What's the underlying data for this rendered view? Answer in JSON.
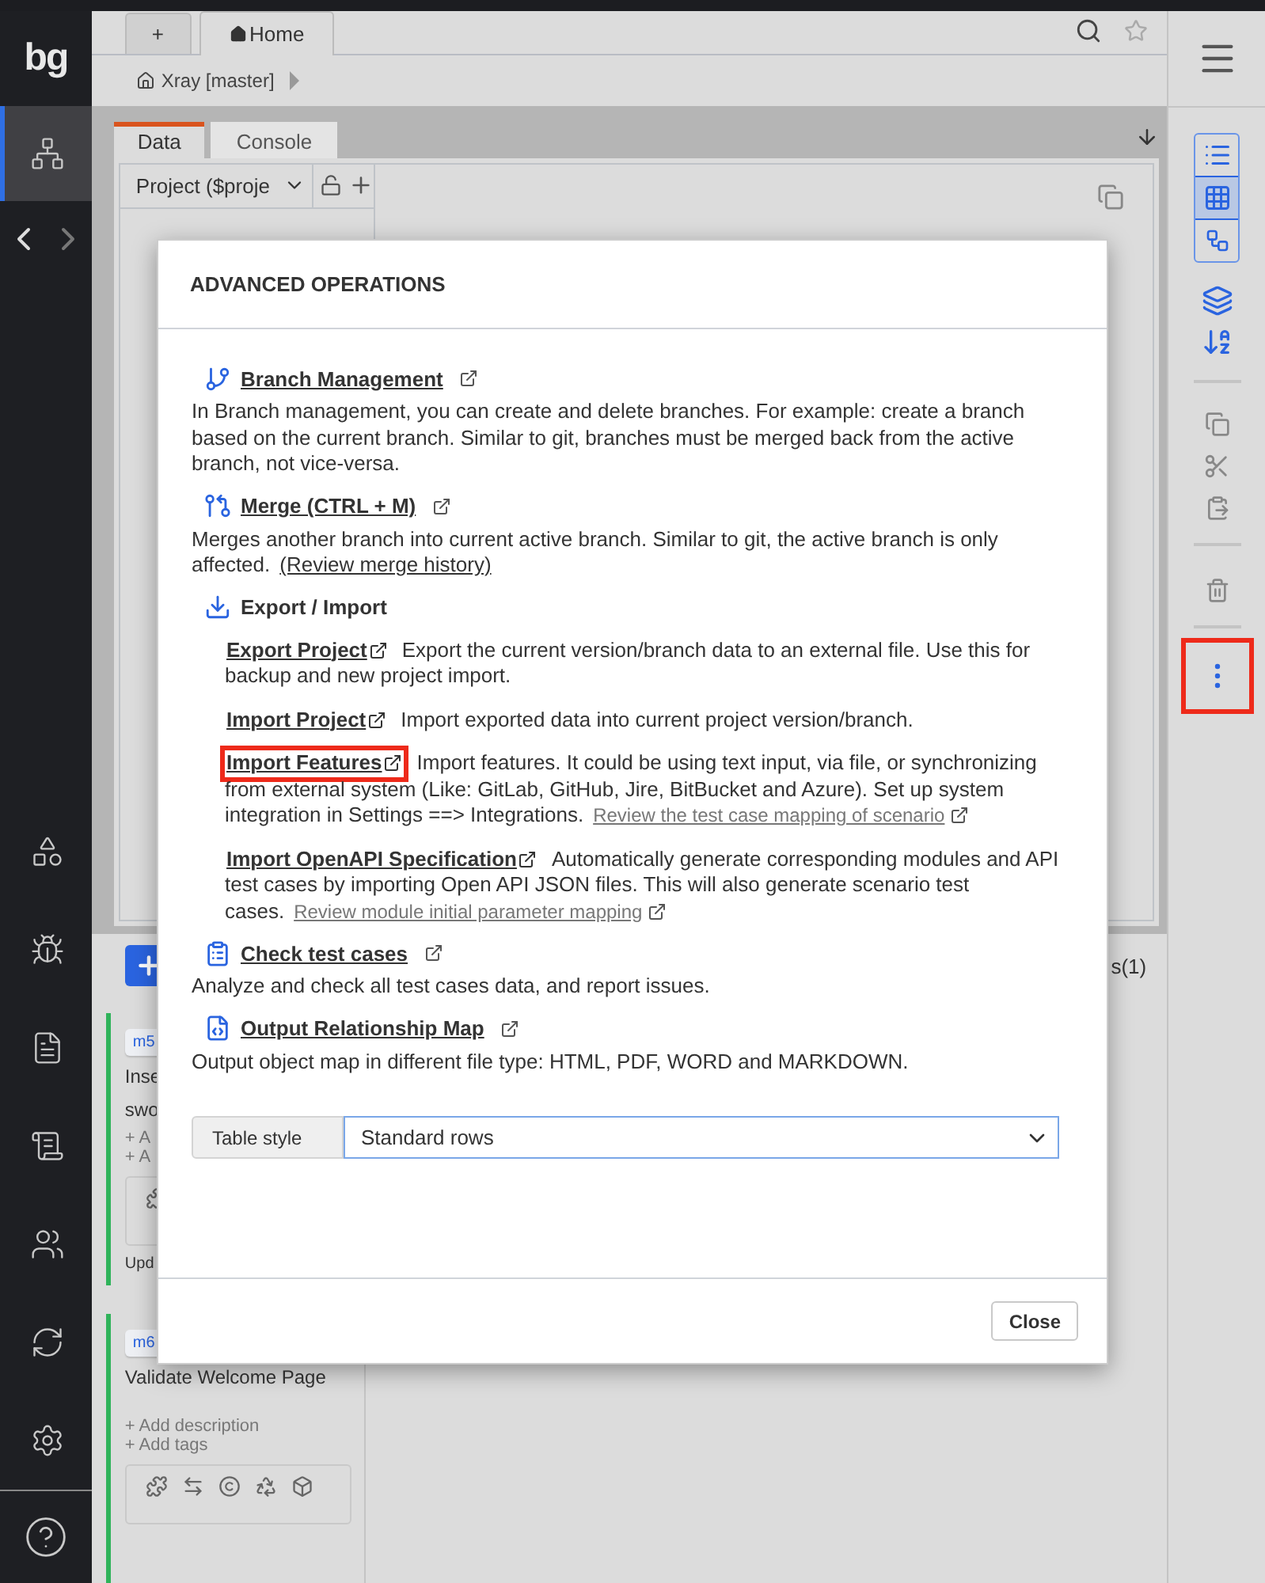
{
  "sidebar": {
    "logo": "bg",
    "items": [
      {
        "kind": "sitemap",
        "selected": true
      },
      {
        "kind": "modules",
        "selected": false
      },
      {
        "kind": "bug",
        "selected": false
      },
      {
        "kind": "report",
        "selected": false
      },
      {
        "kind": "scroll",
        "selected": false
      },
      {
        "kind": "users",
        "selected": false
      },
      {
        "kind": "sync",
        "selected": false
      },
      {
        "kind": "settings",
        "selected": false
      },
      {
        "kind": "help",
        "selected": false
      }
    ]
  },
  "top_tabs": [
    {
      "label": "+",
      "selected": false
    },
    {
      "label": "Home",
      "selected": true
    }
  ],
  "breadcrumb": "Xray [master]",
  "panel_tabs": [
    {
      "label": "Data",
      "selected": true
    },
    {
      "label": "Console",
      "selected": false
    }
  ],
  "project_select": "Project ($proje",
  "right_toolbar": {
    "view_modes": [
      {
        "kind": "list",
        "selected": false
      },
      {
        "kind": "grid",
        "selected": true
      },
      {
        "kind": "tree",
        "selected": false
      }
    ],
    "more_highlighted": true
  },
  "side_label": "s(1)",
  "cards": [
    {
      "tag": "m5",
      "title_lines": [
        "Inse",
        "swo"
      ],
      "actions": [
        "+ A",
        "+ A"
      ],
      "footer": "Upd"
    },
    {
      "tag": "m6",
      "title_lines": [
        "Validate Welcome Page"
      ],
      "actions": [
        "+ Add description",
        "+ Add tags"
      ]
    }
  ],
  "modal": {
    "title": "ADVANCED OPERATIONS",
    "sections": [
      {
        "kind": "item",
        "title": "Branch Management",
        "text": "In Branch management, you can create and delete branches. For example: create a branch based on the current branch. Similar to git, branches must be merged back from the active branch, not vice-versa."
      },
      {
        "kind": "item",
        "title": "Merge (CTRL + M)",
        "text": "Merges another branch into current active branch. Similar to git, the active branch is only affected.",
        "link": "(Review merge history)"
      },
      {
        "kind": "group",
        "title": "Export / Import",
        "children": [
          {
            "title": "Export Project",
            "text": "Export the current version/branch data to an external file. Use this for backup and new project import.",
            "highlighted": false
          },
          {
            "title": "Import Project",
            "text": "Import exported data into current project version/branch.",
            "highlighted": false
          },
          {
            "title": "Import Features",
            "text": "Import features. It could be using text input, via file, or synchronizing from external system (Like: GitLab, GitHub, Jire, BitBucket and Azure). Set up system integration in Settings ==> Integrations.",
            "link": "Review the test case mapping of scenario",
            "highlighted": true
          },
          {
            "title": "Import OpenAPI Specification",
            "text": "Automatically generate corresponding modules and API test cases by importing Open API JSON files. This will also generate scenario test cases.",
            "link": "Review module initial parameter mapping",
            "highlighted": false
          }
        ]
      },
      {
        "kind": "item",
        "title": "Check test cases",
        "text": "Analyze and check all test cases data, and report issues."
      },
      {
        "kind": "item",
        "title": "Output Relationship Map",
        "text": "Output object map in different file type: HTML, PDF, WORD and MARKDOWN."
      }
    ],
    "table_style": {
      "label": "Table style",
      "value": "Standard rows"
    },
    "buttons": [
      "Close"
    ]
  }
}
